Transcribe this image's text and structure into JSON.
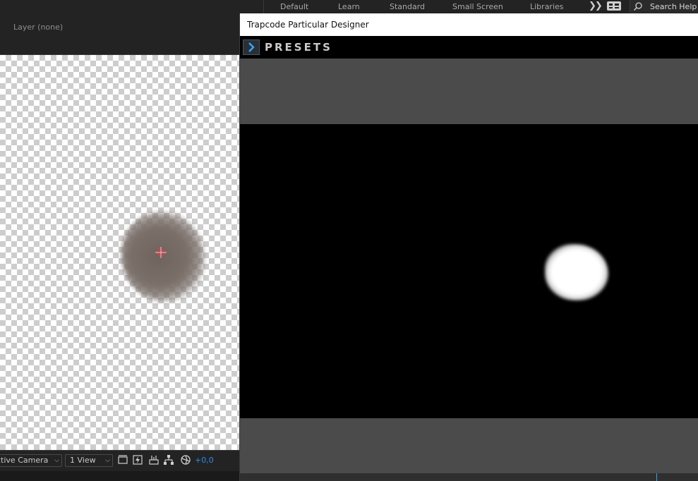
{
  "workspace_tabs": [
    "Default",
    "Learn",
    "Standard",
    "Small Screen",
    "Libraries"
  ],
  "more_workspaces_icon": "double-chevron-right-icon",
  "search": {
    "label": "Search Help",
    "icon": "search-icon"
  },
  "composition_panel": {
    "layer_label": "Layer (none)",
    "toolbar": {
      "camera": "ctive Camera",
      "views": "1 View",
      "exposure": "+0,0"
    }
  },
  "particular_designer": {
    "title": "Trapcode Particular Designer",
    "presets_label": "PRESETS"
  },
  "colors": {
    "accent_blue": "#2d8ceb",
    "preview_bg": "#000000",
    "panel_gray": "#4b4b4b"
  }
}
